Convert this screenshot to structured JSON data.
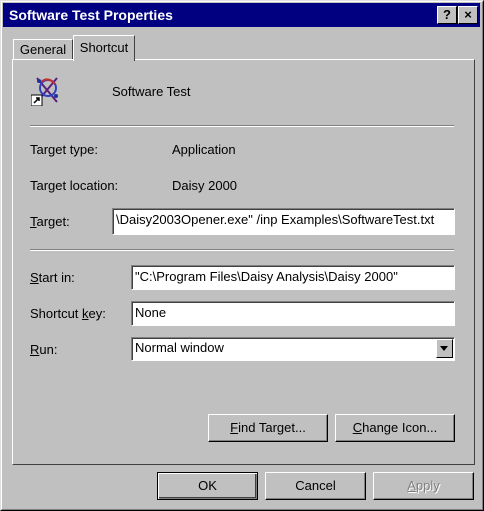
{
  "window": {
    "title": "Software Test Properties",
    "help_button": "?",
    "close_button": "×"
  },
  "tabs": [
    {
      "label": "General"
    },
    {
      "label": "Shortcut"
    }
  ],
  "shortcut": {
    "name": "Software Test",
    "target_type_label": "Target type:",
    "target_type_value": "Application",
    "target_location_label": "Target location:",
    "target_location_value": "Daisy 2000",
    "target_label_prefix": "",
    "target_label_accel": "T",
    "target_label_rest": "arget:",
    "target_value": "\\Daisy2003Opener.exe\" /inp Examples\\SoftwareTest.txt",
    "start_in_label_accel": "S",
    "start_in_label_rest": "tart in:",
    "start_in_value": "\"C:\\Program Files\\Daisy Analysis\\Daisy 2000\"",
    "shortcut_key_label_pre": "Shortcut ",
    "shortcut_key_label_accel": "k",
    "shortcut_key_label_rest": "ey:",
    "shortcut_key_value": "None",
    "run_label_accel": "R",
    "run_label_rest": "un:",
    "run_value": "Normal window",
    "find_target_accel": "F",
    "find_target_rest": "ind Target...",
    "change_icon_accel": "C",
    "change_icon_rest": "hange Icon..."
  },
  "buttons": {
    "ok": "OK",
    "cancel": "Cancel",
    "apply_accel": "A",
    "apply_rest": "pply"
  },
  "icons": {
    "app_icon": "software-test-app-icon",
    "shortcut_overlay": "shortcut-arrow-icon",
    "dropdown": "chevron-down-icon"
  }
}
